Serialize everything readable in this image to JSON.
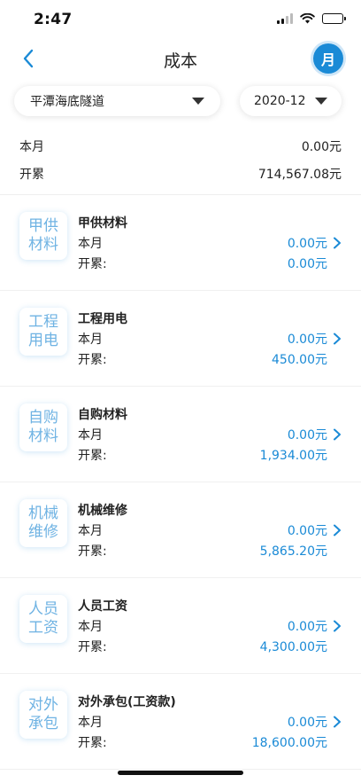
{
  "status_bar": {
    "time": "2:47"
  },
  "nav": {
    "title": "成本",
    "month_label": "月"
  },
  "filters": {
    "project": "平潭海底隧道",
    "date": "2020-12"
  },
  "summary": {
    "month_label": "本月",
    "month_value": "0.00元",
    "total_label": "开累",
    "total_value": "714,567.08元"
  },
  "items": [
    {
      "badge": "甲供材料",
      "title": "甲供材料",
      "month_label": "本月",
      "month_value": "0.00元",
      "total_label": "开累:",
      "total_value": "0.00元"
    },
    {
      "badge": "工程用电",
      "title": "工程用电",
      "month_label": "本月",
      "month_value": "0.00元",
      "total_label": "开累:",
      "total_value": "450.00元"
    },
    {
      "badge": "自购材料",
      "title": "自购材料",
      "month_label": "本月",
      "month_value": "0.00元",
      "total_label": "开累:",
      "total_value": "1,934.00元"
    },
    {
      "badge": "机械维修",
      "title": "机械维修",
      "month_label": "本月",
      "month_value": "0.00元",
      "total_label": "开累:",
      "total_value": "5,865.20元"
    },
    {
      "badge": "人员工资",
      "title": "人员工资",
      "month_label": "本月",
      "month_value": "0.00元",
      "total_label": "开累:",
      "total_value": "4,300.00元"
    },
    {
      "badge": "对外承包",
      "title": "对外承包(工资款)",
      "month_label": "本月",
      "month_value": "0.00元",
      "total_label": "开累:",
      "total_value": "18,600.00元"
    }
  ],
  "colors": {
    "accent": "#1a8ad6",
    "badge_text": "#6fb3e3"
  },
  "icons": {
    "back": "chevron-left-icon",
    "row": "chevron-right-icon",
    "dropdown": "caret-down-icon"
  }
}
